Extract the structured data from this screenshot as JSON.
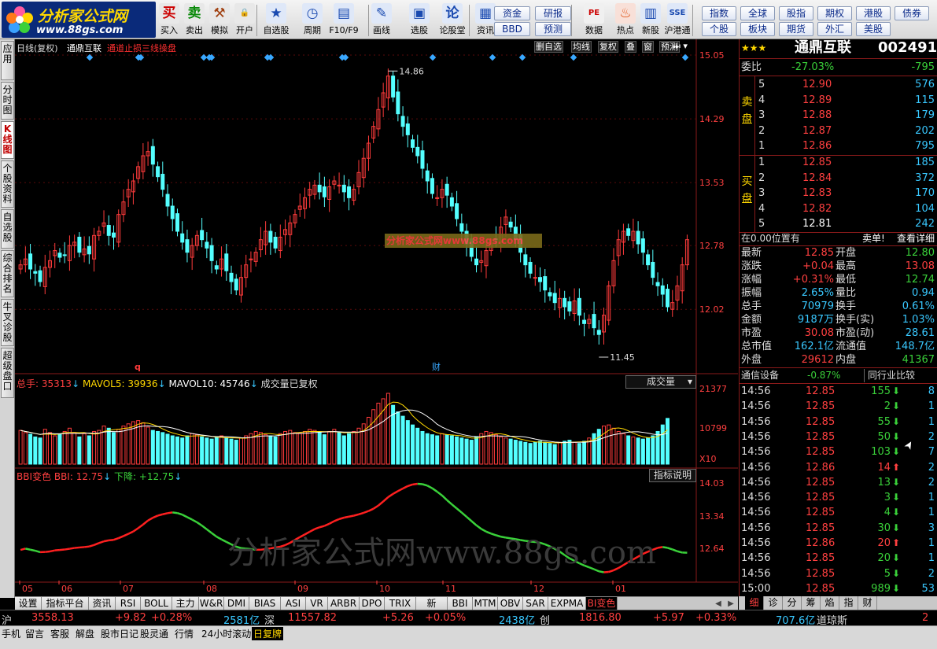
{
  "logo": {
    "brand": "分析家公式网",
    "url": "www.88gs.com"
  },
  "toolbar": {
    "buttons": [
      {
        "label": "买入",
        "icon": "买",
        "name": "buy-button"
      },
      {
        "label": "卖出",
        "icon": "卖",
        "name": "sell-button"
      },
      {
        "label": "模拟",
        "icon": "⚒",
        "name": "simulate-button"
      },
      {
        "label": "开户",
        "icon": "🔒",
        "name": "open-account-button"
      },
      {
        "label": "自选股",
        "icon": "★",
        "name": "watchlist-button"
      },
      {
        "label": "周期",
        "icon": "◷",
        "name": "period-button"
      },
      {
        "label": "F10/F9",
        "icon": "▤",
        "name": "f10-button"
      },
      {
        "label": "画线",
        "icon": "✎",
        "name": "draw-line-button"
      },
      {
        "label": "选股",
        "icon": "▣",
        "name": "stock-picker-button"
      },
      {
        "label": "论股堂",
        "icon": "论",
        "name": "forum-button"
      },
      {
        "label": "资讯",
        "icon": "▦",
        "name": "news-button"
      },
      {
        "label": "数据",
        "icon": "PE",
        "name": "data-button"
      },
      {
        "label": "热点",
        "icon": "♨",
        "name": "hotspot-button"
      },
      {
        "label": "新股",
        "icon": "▥",
        "name": "ipo-button"
      },
      {
        "label": "沪港通",
        "icon": "SSE",
        "name": "hk-connect-button"
      }
    ],
    "mid_pills": [
      "资金",
      "研报",
      "BBD",
      "预测"
    ],
    "right_pills": [
      "指数",
      "全球",
      "股指",
      "期权",
      "港股",
      "债券",
      "个股",
      "板块",
      "期货",
      "外汇",
      "美股"
    ]
  },
  "left_tabs": [
    "应用",
    "分时图",
    "K线图",
    "个股资料",
    "自选股",
    "综合排名",
    "牛叉诊股",
    "超级盘口"
  ],
  "chart_header": {
    "left": "日线(复权)",
    "name": "通鼎互联",
    "indicator": "通道止损三线操盘",
    "right_buttons": [
      "删自选",
      "均线",
      "复权",
      "叠",
      "窗",
      "预测"
    ]
  },
  "watermark_box": "分析家公式网www.88gs.com",
  "watermark_big": "分析家公式网www.88gs.com",
  "chart_data": [
    {
      "type": "candlestick",
      "title": "日线(复权)",
      "y_ticks": [
        "15.05",
        "14.29",
        "13.53",
        "12.78",
        "12.02"
      ],
      "ylim": [
        11.3,
        15.05
      ],
      "annotations": {
        "high": "14.86",
        "low": "11.45"
      },
      "markers": [
        "q",
        "财"
      ],
      "x_ticks": [
        "05",
        "06",
        "07",
        "08",
        "09",
        "10",
        "11",
        "12",
        "01"
      ],
      "closes": [
        12.55,
        12.62,
        12.5,
        12.45,
        12.35,
        12.52,
        12.6,
        12.72,
        12.64,
        12.66,
        12.78,
        12.82,
        12.7,
        12.74,
        12.68,
        12.9,
        12.95,
        13.05,
        12.9,
        12.88,
        13.15,
        13.3,
        13.45,
        13.55,
        13.72,
        13.85,
        13.9,
        13.75,
        13.6,
        13.45,
        13.25,
        13.1,
        12.95,
        12.82,
        12.7,
        12.78,
        12.9,
        12.85,
        12.75,
        12.6,
        12.5,
        12.62,
        12.48,
        12.35,
        12.25,
        12.4,
        12.55,
        12.62,
        12.7,
        12.85,
        12.95,
        12.82,
        12.75,
        12.88,
        12.97,
        13.05,
        13.15,
        13.25,
        13.35,
        13.45,
        13.5,
        13.42,
        13.36,
        13.48,
        13.55,
        13.5,
        13.42,
        13.35,
        13.45,
        13.65,
        13.82,
        14.0,
        14.2,
        14.4,
        14.6,
        14.8,
        14.55,
        14.35,
        14.2,
        14.1,
        13.95,
        13.85,
        13.7,
        13.55,
        13.4,
        13.35,
        13.45,
        13.38,
        13.25,
        13.1,
        12.95,
        12.8,
        12.65,
        12.55,
        12.6,
        12.72,
        12.8,
        12.85,
        13.0,
        13.12,
        13.0,
        12.85,
        12.7,
        12.55,
        12.45,
        12.4,
        12.35,
        12.25,
        12.18,
        12.1,
        12.15,
        12.05,
        12.0,
        12.12,
        11.95,
        11.85,
        11.9,
        11.8,
        11.72,
        11.95,
        12.3,
        12.6,
        12.85,
        12.95,
        12.9,
        12.95,
        12.8,
        12.7,
        12.55,
        12.4,
        12.3,
        12.2,
        12.05,
        12.1,
        12.3,
        12.55,
        12.85
      ],
      "volume_ticks": [
        "21377",
        "10799",
        "X10"
      ],
      "volume_header": {
        "label": "总手",
        "total": "35313",
        "mavol5_label": "MAVOL5:",
        "mavol5": "39936",
        "mavol10_label": "MAVOL10:",
        "mavol10": "45746",
        "note": "成交量已复权",
        "select": "成交量"
      },
      "volumes": [
        62,
        58,
        55,
        50,
        48,
        64,
        58,
        52,
        55,
        60,
        66,
        58,
        50,
        56,
        52,
        60,
        62,
        70,
        66,
        58,
        64,
        70,
        74,
        78,
        80,
        76,
        68,
        62,
        60,
        58,
        55,
        52,
        50,
        48,
        52,
        56,
        54,
        50,
        48,
        46,
        50,
        52,
        48,
        46,
        44,
        48,
        52,
        56,
        60,
        58,
        54,
        52,
        50,
        56,
        60,
        62,
        58,
        56,
        60,
        64,
        62,
        58,
        54,
        60,
        64,
        58,
        52,
        56,
        60,
        66,
        74,
        86,
        100,
        112,
        120,
        130,
        108,
        96,
        88,
        80,
        72,
        66,
        60,
        56,
        54,
        52,
        56,
        54,
        52,
        50,
        48,
        46,
        44,
        50,
        56,
        60,
        58,
        54,
        50,
        48,
        46,
        44,
        42,
        40,
        38,
        40,
        42,
        40,
        38,
        36,
        40,
        42,
        44,
        40,
        38,
        42,
        48,
        56,
        64,
        70,
        72,
        66,
        60,
        56,
        52,
        50,
        48,
        46,
        48,
        52,
        60,
        72,
        84
      ],
      "bbi_header": {
        "label": "BBI变色",
        "bbi": "BBI: 12.75",
        "down": "下降: +12.75"
      },
      "bbi_ticks": [
        "14.03",
        "13.34",
        "12.64"
      ],
      "bbi_button": "指标说明"
    }
  ],
  "quote": {
    "name": "通鼎互联",
    "code": "002491",
    "stars": "★★★",
    "webi_label": "委比",
    "webi": "-27.03%",
    "webi_diff": "-795",
    "sell_label": "卖盘",
    "buy_label": "买盘",
    "asks": [
      {
        "lvl": "5",
        "price": "12.90",
        "vol": "576"
      },
      {
        "lvl": "4",
        "price": "12.89",
        "vol": "115"
      },
      {
        "lvl": "3",
        "price": "12.88",
        "vol": "179"
      },
      {
        "lvl": "2",
        "price": "12.87",
        "vol": "202"
      },
      {
        "lvl": "1",
        "price": "12.86",
        "vol": "795"
      }
    ],
    "bids": [
      {
        "lvl": "1",
        "price": "12.85",
        "vol": "185"
      },
      {
        "lvl": "2",
        "price": "12.84",
        "vol": "372"
      },
      {
        "lvl": "3",
        "price": "12.83",
        "vol": "170"
      },
      {
        "lvl": "4",
        "price": "12.82",
        "vol": "104"
      },
      {
        "lvl": "5",
        "price": "12.81",
        "vol": "242"
      }
    ],
    "pos_text": "在0.00位置有",
    "sell_note": "卖单!",
    "detail_link": "查看详细",
    "stats": [
      [
        "最新",
        "12.85",
        "开盘",
        "12.80"
      ],
      [
        "涨跌",
        "+0.04",
        "最高",
        "13.08"
      ],
      [
        "涨幅",
        "+0.31%",
        "最低",
        "12.74"
      ],
      [
        "振幅",
        "2.65%",
        "量比",
        "0.94"
      ],
      [
        "总手",
        "70979",
        "换手",
        "0.61%"
      ],
      [
        "金额",
        "9187万",
        "换手(实)",
        "1.03%"
      ],
      [
        "市盈",
        "30.08",
        "市盈(动)",
        "28.61"
      ],
      [
        "总市值",
        "162.1亿",
        "流通值",
        "148.7亿"
      ],
      [
        "外盘",
        "29612",
        "内盘",
        "41367"
      ]
    ],
    "comm_label": "通信设备",
    "comm_pct": "-0.87%",
    "compare_btn": "同行业比较",
    "ticks": [
      [
        "14:56",
        "12.85",
        "155",
        "down",
        "8"
      ],
      [
        "14:56",
        "12.85",
        "2",
        "down",
        "1"
      ],
      [
        "14:56",
        "12.85",
        "55",
        "down",
        "1"
      ],
      [
        "14:56",
        "12.85",
        "50",
        "down",
        "2"
      ],
      [
        "14:56",
        "12.85",
        "103",
        "down",
        "7"
      ],
      [
        "14:56",
        "12.86",
        "14",
        "up",
        "2"
      ],
      [
        "14:56",
        "12.85",
        "13",
        "down",
        "2"
      ],
      [
        "14:56",
        "12.85",
        "3",
        "down",
        "1"
      ],
      [
        "14:56",
        "12.85",
        "4",
        "down",
        "1"
      ],
      [
        "14:56",
        "12.85",
        "30",
        "down",
        "3"
      ],
      [
        "14:56",
        "12.86",
        "20",
        "up",
        "1"
      ],
      [
        "14:56",
        "12.85",
        "20",
        "down",
        "1"
      ],
      [
        "14:56",
        "12.85",
        "5",
        "down",
        "2"
      ],
      [
        "15:00",
        "12.85",
        "989",
        "down",
        "53"
      ]
    ]
  },
  "bottom_tabs": [
    "设置",
    "指标平台",
    "资讯",
    "RSI",
    "BOLL",
    "主力",
    "W&R",
    "DMI",
    "BIAS",
    "ASI",
    "VR",
    "ARBR",
    "DPO",
    "TRIX",
    "新DMA",
    "BBI",
    "MTM",
    "OBV",
    "SAR",
    "EXPMA",
    "BI变色"
  ],
  "right_bottom_tabs": [
    "细",
    "诊",
    "分",
    "筹",
    "焰",
    "指",
    "财"
  ],
  "index_bar": {
    "sh_label": "沪",
    "sh_val": "3558.13",
    "sh_chg": "+9.82",
    "sh_pct": "+0.28%",
    "sh_amt": "2581亿",
    "sz_label": "深",
    "sz_val": "11557.82",
    "sz_chg": "+5.26",
    "sz_pct": "+0.05%",
    "sz_amt": "2438亿",
    "cy_label": "创",
    "cy_val": "1816.80",
    "cy_chg": "+5.97",
    "cy_pct": "+0.33%",
    "cy_amt": "707.6亿",
    "dj_label": "道琼斯",
    "dj_val": "2"
  },
  "status_bar": [
    "手机",
    "留言",
    "客服",
    "解盘",
    "股市日记",
    "股灵通",
    "行情",
    "24小时滚动",
    "日复牌"
  ]
}
